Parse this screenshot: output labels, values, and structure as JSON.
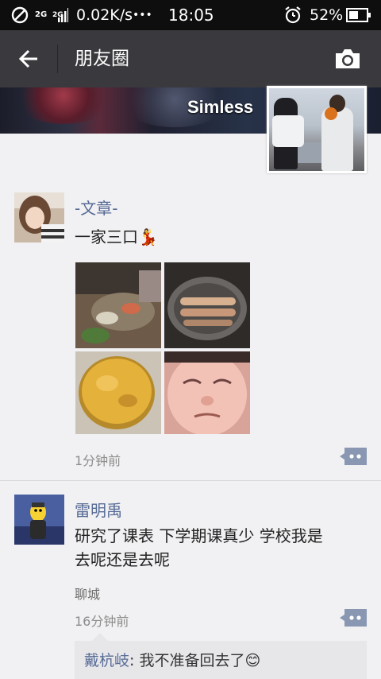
{
  "status_bar": {
    "net_2g_a": "2G",
    "net_2g_b": "2G",
    "speed": "0.02K/s",
    "dots": "•••",
    "time": "18:05",
    "battery": "52%"
  },
  "title_bar": {
    "title": "朋友圈"
  },
  "cover": {
    "name": "Simless"
  },
  "posts": [
    {
      "author": "-文章-",
      "text": "一家三口💃",
      "time": "1分钟前"
    },
    {
      "author": "雷明禹",
      "text_line1": "研究了课表 下学期课真少 学校我是",
      "text_line2": "去呢还是去呢",
      "location": "聊城",
      "time": "16分钟前",
      "comments": [
        {
          "author": "戴杭岐",
          "separator": ": ",
          "text": "我不准备回去了😊"
        }
      ]
    }
  ],
  "colors": {
    "status_bar_bg": "#0e0e0e",
    "title_bar_bg": "#3a393e",
    "page_bg": "#f1f1f3",
    "name_link": "#576b95",
    "comment_button": "#8a97b2"
  }
}
